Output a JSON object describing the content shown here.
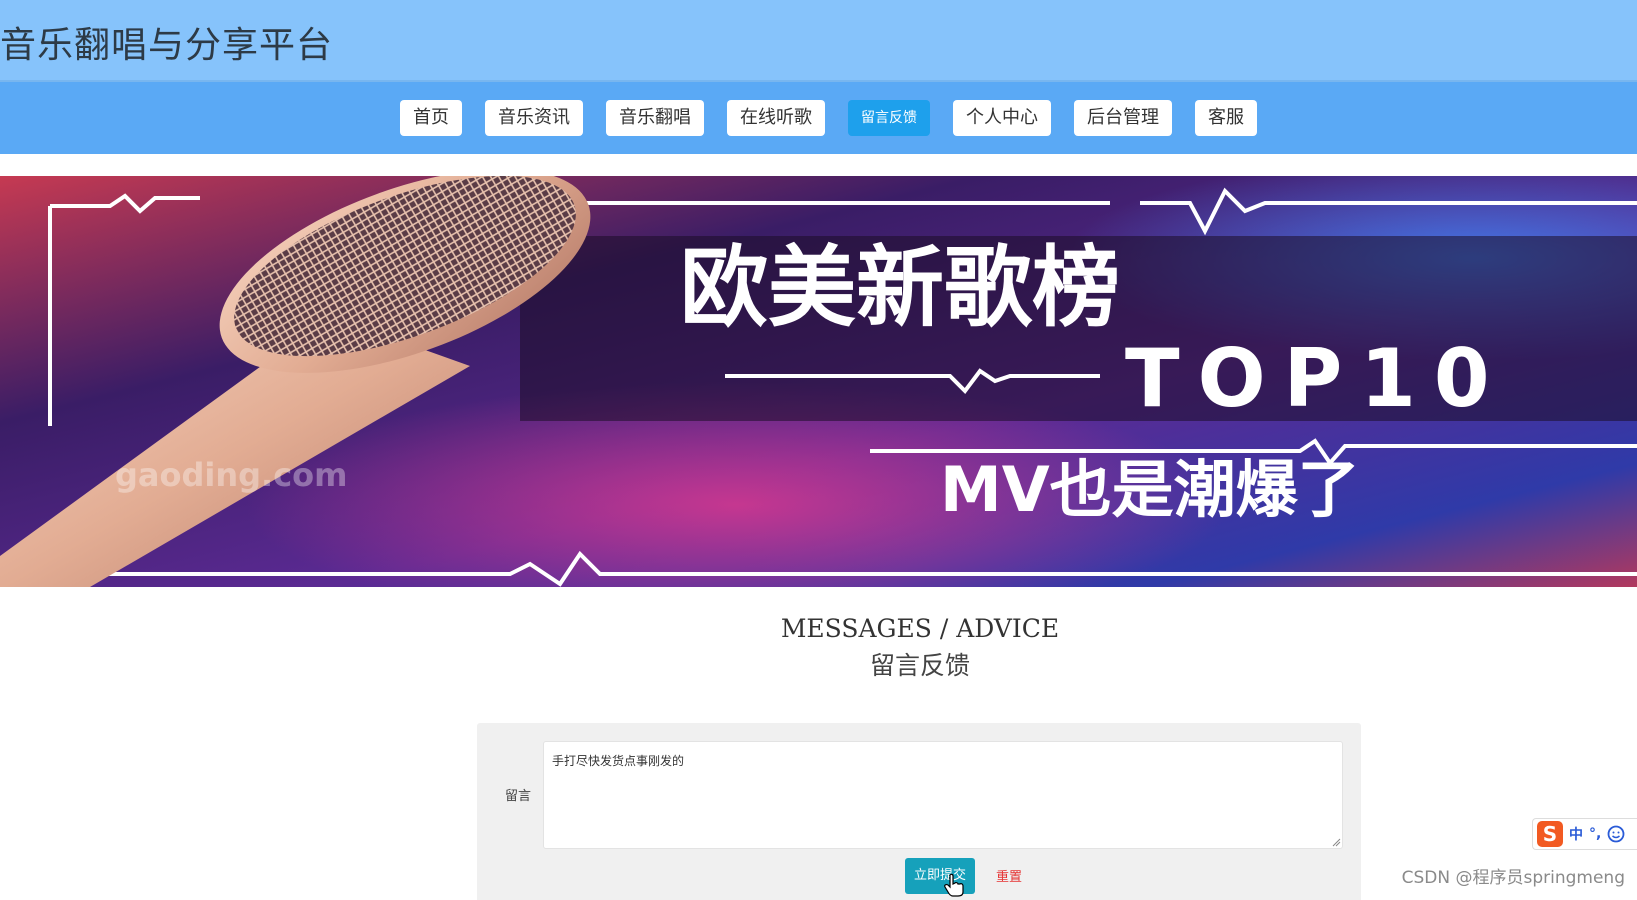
{
  "header": {
    "title": "音乐翻唱与分享平台"
  },
  "nav": {
    "items": [
      {
        "label": "首页"
      },
      {
        "label": "音乐资讯"
      },
      {
        "label": "音乐翻唱"
      },
      {
        "label": "在线听歌"
      },
      {
        "label": "留言反馈",
        "active": true
      },
      {
        "label": "个人中心"
      },
      {
        "label": "后台管理"
      },
      {
        "label": "客服"
      }
    ]
  },
  "banner": {
    "headline": "欧美新歌榜",
    "subline": "TOP10",
    "tagline": "MV也是潮爆了",
    "watermark": "gaoding.com",
    "icon": "microphone"
  },
  "section": {
    "title_en": "MESSAGES / ADVICE",
    "title_cn": "留言反馈"
  },
  "form": {
    "label": "留言",
    "message_value": "手打尽快发货点事刚发的",
    "submit_label": "立即提交",
    "reset_label": "重置"
  },
  "ime": {
    "lang": "中",
    "punct": "°,",
    "icons": [
      "sogou-s-icon",
      "emoji-icon"
    ]
  },
  "watermark": "CSDN @程序员springmeng",
  "colors": {
    "header": "#86c3fb",
    "navbar": "#5aa9f5",
    "nav_active": "#1ea0ec",
    "submit": "#16a1bb",
    "reset": "#e53333"
  }
}
